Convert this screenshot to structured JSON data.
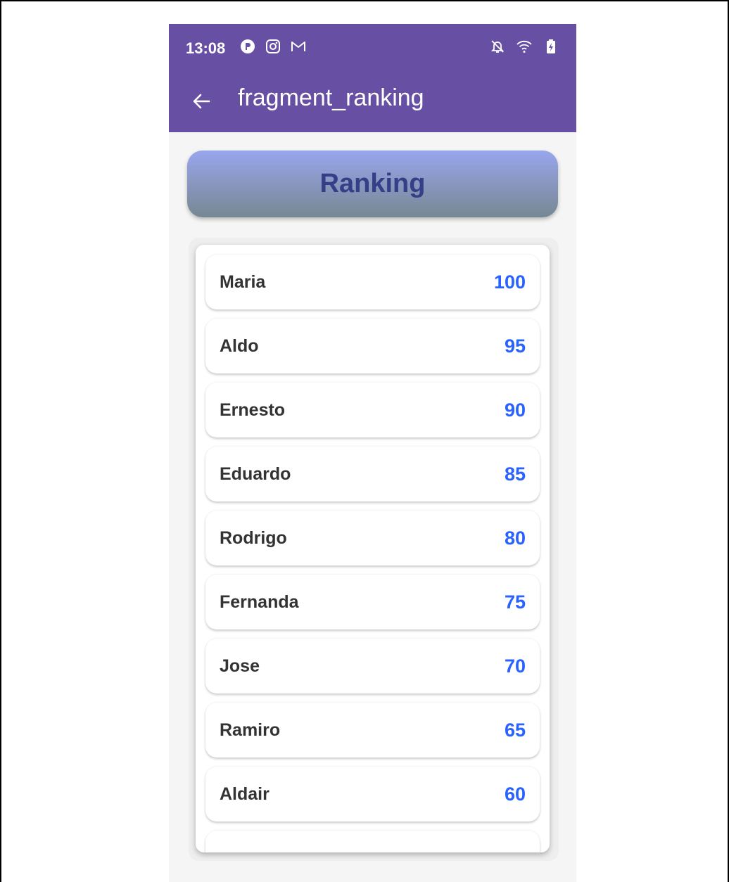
{
  "status_bar": {
    "time": "13:08",
    "left_icons": [
      "app-notification-icon",
      "instagram-icon",
      "gmail-icon"
    ],
    "right_icons": [
      "bell-muted-icon",
      "wifi-icon",
      "battery-charging-icon"
    ]
  },
  "app_bar": {
    "title": "fragment_ranking",
    "back_icon": "arrow-back-icon"
  },
  "header": {
    "title": "Ranking"
  },
  "ranking": [
    {
      "name": "Maria",
      "score": "100"
    },
    {
      "name": "Aldo",
      "score": "95"
    },
    {
      "name": "Ernesto",
      "score": "90"
    },
    {
      "name": "Eduardo",
      "score": "85"
    },
    {
      "name": "Rodrigo",
      "score": "80"
    },
    {
      "name": "Fernanda",
      "score": "75"
    },
    {
      "name": "Jose",
      "score": "70"
    },
    {
      "name": "Ramiro",
      "score": "65"
    },
    {
      "name": "Aldair",
      "score": "60"
    },
    {
      "name": "",
      "score": ""
    }
  ],
  "colors": {
    "primary": "#6750a4",
    "score": "#2962ff",
    "header_text": "#333f86",
    "name_text": "#333333"
  }
}
